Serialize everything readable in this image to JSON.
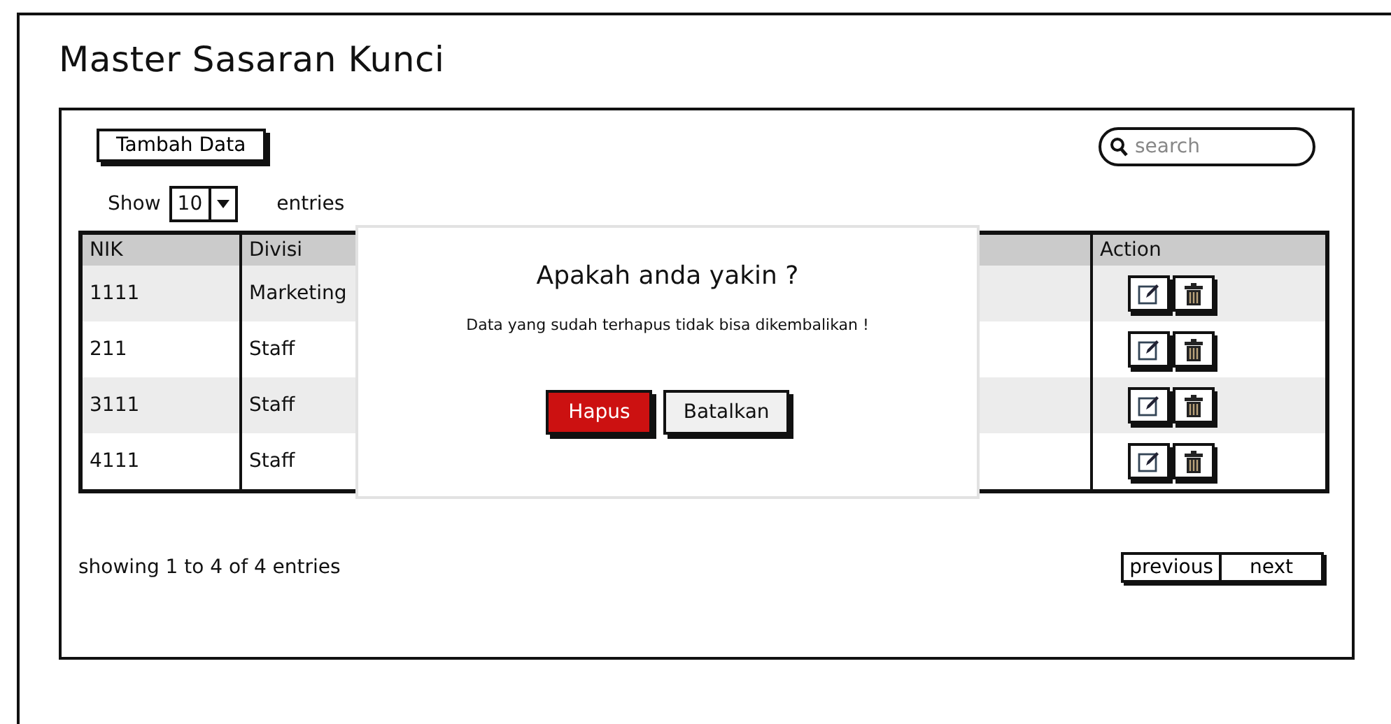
{
  "title": "Master Sasaran Kunci",
  "add_button": "Tambah Data",
  "search": {
    "placeholder": "search"
  },
  "entries": {
    "show_label": "Show",
    "value": "10",
    "suffix": "entries"
  },
  "table": {
    "columns": [
      "NIK",
      "Divisi",
      "Action"
    ],
    "rows": [
      {
        "nik": "1111",
        "divisi": "Marketing"
      },
      {
        "nik": "211",
        "divisi": "Staff"
      },
      {
        "nik": "3111",
        "divisi": "Staff"
      },
      {
        "nik": "4111",
        "divisi": "Staff"
      }
    ]
  },
  "dialog": {
    "title": "Apakah anda yakin ?",
    "message": "Data yang sudah terhapus tidak bisa dikembalikan !",
    "buttons": [
      {
        "label": "Hapus",
        "kind": "danger"
      },
      {
        "label": "Batalkan",
        "kind": "default"
      }
    ]
  },
  "footer": {
    "info": "showing 1 to 4 of 4 entries",
    "pagination": [
      "previous",
      "next"
    ]
  }
}
